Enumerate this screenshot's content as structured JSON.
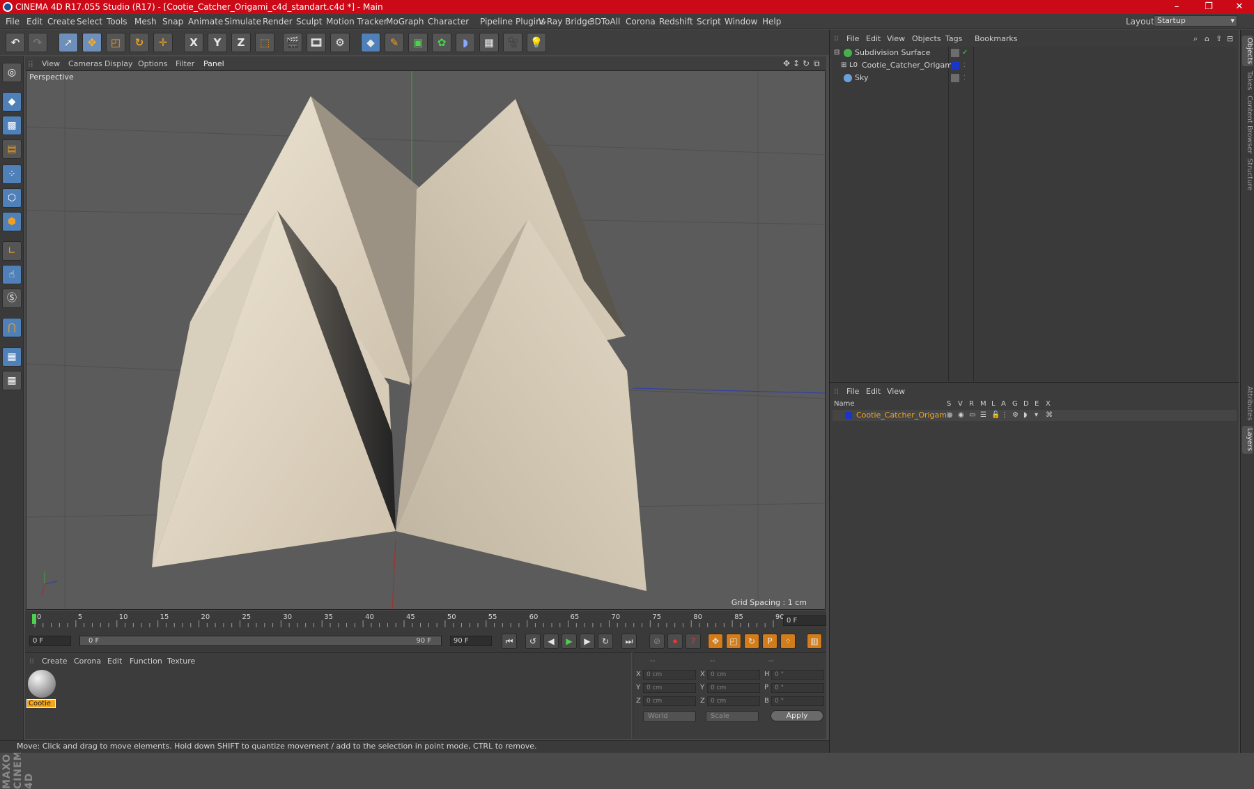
{
  "window": {
    "title": "CINEMA 4D R17.055 Studio (R17) - [Cootie_Catcher_Origami_c4d_standart.c4d *] - Main",
    "min": "–",
    "max": "❐",
    "close": "✕"
  },
  "menu": [
    "File",
    "Edit",
    "Create",
    "Select",
    "Tools",
    "Mesh",
    "Snap",
    "Animate",
    "Simulate",
    "Render",
    "Sculpt",
    "Motion Tracker",
    "MoGraph",
    "Character",
    "Pipeline",
    "Plugins",
    "V-Ray Bridge",
    "3DToAll",
    "Corona",
    "Redshift",
    "Script",
    "Window",
    "Help"
  ],
  "layout": {
    "label": "Layout:",
    "value": "Startup"
  },
  "toolbar": {
    "x_axis": "X",
    "y_axis": "Y",
    "z_axis": "Z"
  },
  "viewport": {
    "menu": [
      "View",
      "Cameras",
      "Display",
      "Options",
      "Filter",
      "Panel"
    ],
    "name": "Perspective",
    "grid_spacing": "Grid Spacing : 1 cm"
  },
  "timeline": {
    "ticks": [
      "0",
      "5",
      "10",
      "15",
      "20",
      "25",
      "30",
      "35",
      "40",
      "45",
      "50",
      "55",
      "60",
      "65",
      "70",
      "75",
      "80",
      "85",
      "90"
    ],
    "current_frame": "0 F"
  },
  "playback": {
    "start": "0 F",
    "range_start": "0 F",
    "range_end": "90 F",
    "end": "90 F"
  },
  "material_panel": {
    "menu": [
      "Create",
      "Corona",
      "Edit",
      "Function",
      "Texture"
    ],
    "material_name": "Cootie"
  },
  "coords": {
    "headers": [
      "--",
      "--",
      "--"
    ],
    "pos_labels": [
      "X",
      "Y",
      "Z"
    ],
    "pos_values": [
      "0 cm",
      "0 cm",
      "0 cm"
    ],
    "size_labels": [
      "X",
      "Y",
      "Z"
    ],
    "size_values": [
      "0 cm",
      "0 cm",
      "0 cm"
    ],
    "rot_labels": [
      "H",
      "P",
      "B"
    ],
    "rot_values": [
      "0 °",
      "0 °",
      "0 °"
    ],
    "mode1": "World",
    "mode2": "Scale",
    "apply": "Apply"
  },
  "status": "Move: Click and drag to move elements. Hold down SHIFT to quantize movement / add to the selection in point mode, CTRL to remove.",
  "objects_panel": {
    "menu": [
      "File",
      "Edit",
      "View",
      "Objects",
      "Tags",
      "Bookmarks"
    ],
    "objects": [
      {
        "name": "Subdivision Surface",
        "color": "#47b04b"
      },
      {
        "name": "Cootie_Catcher_Origami",
        "color": "#c8c8c8"
      },
      {
        "name": "Sky",
        "color": "#6aa0d8"
      }
    ]
  },
  "layers_panel": {
    "menu": [
      "File",
      "Edit",
      "View"
    ],
    "columns": [
      "Name",
      "S",
      "V",
      "R",
      "M",
      "L",
      "A",
      "G",
      "D",
      "E",
      "X"
    ],
    "layer": {
      "name": "Cootie_Catcher_Origami",
      "color": "#1a35c9"
    }
  },
  "side_tabs": [
    "Objects",
    "Takes",
    "Content Browser",
    "Structure",
    "Attributes",
    "Layers"
  ],
  "maxon": "MAXON CINEMA 4D"
}
